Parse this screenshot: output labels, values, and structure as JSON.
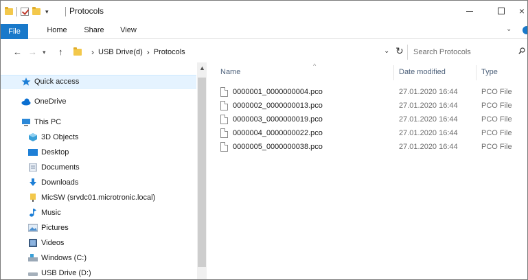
{
  "window": {
    "title": "Protocols",
    "controls": {
      "minimize": "—",
      "maximize": "",
      "close": "×"
    }
  },
  "ribbon": {
    "tabs": [
      {
        "label": "File"
      },
      {
        "label": "Home"
      },
      {
        "label": "Share"
      },
      {
        "label": "View"
      }
    ],
    "expand": "⌄"
  },
  "address": {
    "breadcrumb": [
      "USB Drive(d)",
      "Protocols"
    ],
    "separator": "›",
    "search_placeholder": "Search Protocols"
  },
  "nav": {
    "items": [
      {
        "label": "Quick access",
        "icon": "star-icon",
        "selected": true
      },
      {
        "label": "OneDrive",
        "icon": "cloud-icon"
      },
      {
        "label": "This PC",
        "icon": "computer-icon"
      },
      {
        "label": "3D Objects",
        "icon": "cube-icon"
      },
      {
        "label": "Desktop",
        "icon": "desktop-icon"
      },
      {
        "label": "Documents",
        "icon": "document-icon"
      },
      {
        "label": "Downloads",
        "icon": "download-icon"
      },
      {
        "label": "MicSW (srvdc01.microtronic.local)",
        "icon": "network-folder-icon"
      },
      {
        "label": "Music",
        "icon": "music-icon"
      },
      {
        "label": "Pictures",
        "icon": "pictures-icon"
      },
      {
        "label": "Videos",
        "icon": "videos-icon"
      },
      {
        "label": "Windows (C:)",
        "icon": "drive-icon"
      },
      {
        "label": "USB Drive (D:)",
        "icon": "usb-drive-icon"
      }
    ]
  },
  "files": {
    "columns": {
      "name": "Name",
      "date": "Date modified",
      "type": "Type"
    },
    "rows": [
      {
        "name": "0000001_0000000004.pco",
        "date": "27.01.2020 16:44",
        "type": "PCO File"
      },
      {
        "name": "0000002_0000000013.pco",
        "date": "27.01.2020 16:44",
        "type": "PCO File"
      },
      {
        "name": "0000003_0000000019.pco",
        "date": "27.01.2020 16:44",
        "type": "PCO File"
      },
      {
        "name": "0000004_0000000022.pco",
        "date": "27.01.2020 16:44",
        "type": "PCO File"
      },
      {
        "name": "0000005_0000000038.pco",
        "date": "27.01.2020 16:44",
        "type": "PCO File"
      }
    ]
  },
  "colors": {
    "accent": "#1979ca",
    "selection": "#e5f3ff",
    "header_text": "#4c607a"
  }
}
